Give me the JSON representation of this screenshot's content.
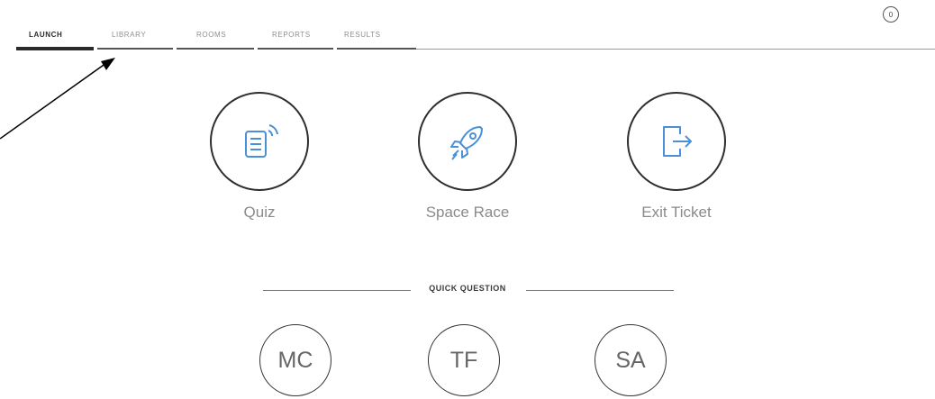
{
  "nav": {
    "tabs": [
      {
        "label": "LAUNCH",
        "active": true
      },
      {
        "label": "LIBRARY",
        "active": false
      },
      {
        "label": "ROOMS",
        "active": false
      },
      {
        "label": "REPORTS",
        "active": false
      },
      {
        "label": "RESULTS",
        "active": false
      }
    ],
    "profile_badge": "0",
    "profile_icon": "profile-circle-icon"
  },
  "activities": [
    {
      "label": "Quiz",
      "icon": "quiz-icon"
    },
    {
      "label": "Space Race",
      "icon": "rocket-icon"
    },
    {
      "label": "Exit Ticket",
      "icon": "exit-door-icon"
    }
  ],
  "quick_question": {
    "title": "QUICK QUESTION",
    "buttons": [
      {
        "label": "MC"
      },
      {
        "label": "TF"
      },
      {
        "label": "SA"
      }
    ]
  },
  "annotation": {
    "type": "arrow",
    "color": "#000000",
    "points_to": "LIBRARY tab"
  },
  "colors": {
    "accent": "#2a2a2a",
    "icon_blue": "#4a90d9",
    "muted_text": "#8a8a8a"
  }
}
